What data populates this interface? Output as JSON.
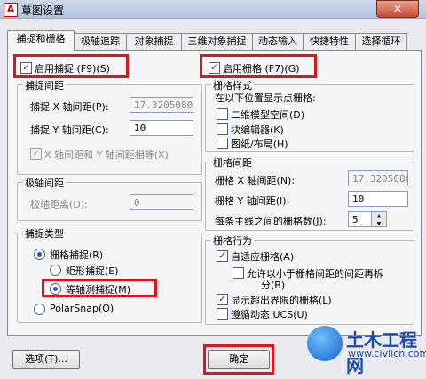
{
  "window": {
    "title": "草图设置",
    "app_icon": "A",
    "close_glyph": "✕"
  },
  "tabs": [
    "捕捉和栅格",
    "极轴追踪",
    "对象捕捉",
    "三维对象捕捉",
    "动态输入",
    "快捷特性",
    "选择循环"
  ],
  "snap": {
    "enable_label": "启用捕捉 (F9)(S)",
    "spacing_group": "捕捉间距",
    "x_label": "捕捉 X 轴间距(P):",
    "x_value": "17.3205080",
    "y_label": "捕捉 Y 轴间距(C):",
    "y_value": "10",
    "equal_label": "X 轴间距和 Y 轴间距相等(X)"
  },
  "polar": {
    "group": "极轴间距",
    "label": "极轴距离(D):",
    "value": "0"
  },
  "snap_type": {
    "group": "捕捉类型",
    "grid_snap": "栅格捕捉(R)",
    "rect_snap": "矩形捕捉(E)",
    "iso_snap": "等轴测捕捉(M)",
    "polar_snap": "PolarSnap(O)"
  },
  "grid": {
    "enable_label": "启用栅格 (F7)(G)",
    "style_group": "栅格样式",
    "style_desc": "在以下位置显示点栅格:",
    "model_space": "二维模型空间(D)",
    "block_editor": "块编辑器(K)",
    "sheet_layout": "图纸/布局(H)",
    "spacing_group": "栅格间距",
    "gx_label": "栅格 X 轴间距(N):",
    "gx_value": "17.3205080",
    "gy_label": "栅格 Y 轴间距(I):",
    "gy_value": "10",
    "major_label": "每条主线之间的栅格数(J):",
    "major_value": "5",
    "behavior_group": "栅格行为",
    "adaptive": "自适应栅格(A)",
    "subdivide_line1": "允许以小于栅格间距的间距再拆",
    "subdivide_line2": "分(B)",
    "beyond_limits": "显示超出界限的栅格(L)",
    "follow_ucs": "遵循动态 UCS(U)"
  },
  "buttons": {
    "options": "选项(T)...",
    "ok": "确定"
  },
  "watermark": {
    "name": "土木工程网",
    "url": "www.civilcn.com"
  },
  "colors": {
    "highlight": "#e1141c",
    "accent": "#2b58b8"
  }
}
